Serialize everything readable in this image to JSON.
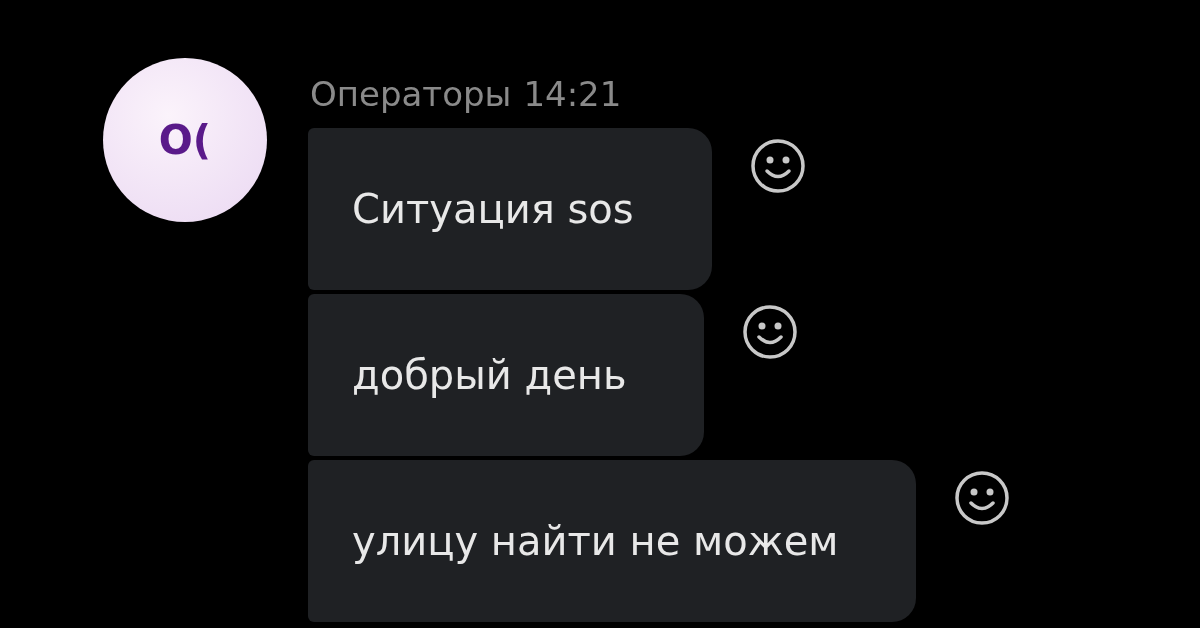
{
  "message_group": {
    "avatar_text": "O(",
    "sender": "Операторы",
    "time": "14:21",
    "messages": [
      {
        "text": "Ситуация sos"
      },
      {
        "text": "добрый день"
      },
      {
        "text": "улицу найти не можем"
      }
    ]
  }
}
